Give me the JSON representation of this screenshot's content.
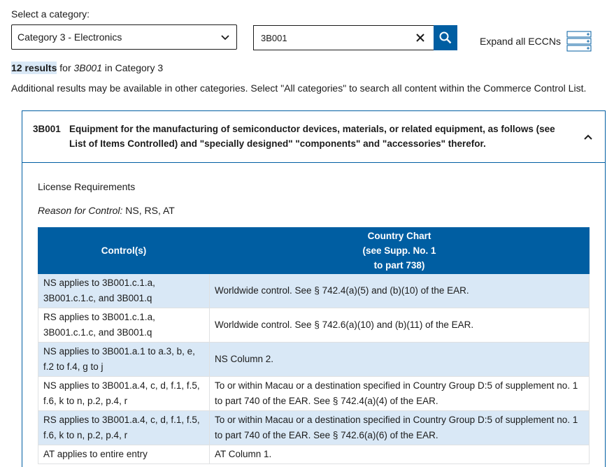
{
  "filters": {
    "category_label": "Select a category:",
    "category_value": "Category 3 - Electronics",
    "search_value": "3B001",
    "expand_all_label": "Expand all ECCNs"
  },
  "results": {
    "count": "12 results",
    "for_word": "for",
    "term": "3B001",
    "in_text": "in Category 3",
    "additional": "Additional results may be available in other categories. Select \"All categories\" to search all content within the Commerce Control List."
  },
  "eccn": {
    "code": "3B001",
    "title": "Equipment for the manufacturing of semiconductor devices, materials, or related equipment, as follows (see List of Items Controlled) and \"specially designed\" \"components\" and \"accessories\" therefor.",
    "license_requirements": "License Requirements",
    "reason_label": "Reason for Control:",
    "reason_value": "NS, RS, AT",
    "table": {
      "col1_header": "Control(s)",
      "col2_header_lines": [
        "Country Chart",
        "(see Supp. No. 1",
        "to part 738)"
      ],
      "rows": [
        {
          "control": "NS applies to 3B001.c.1.a, 3B001.c.1.c, and 3B001.q",
          "chart": "Worldwide control. See § 742.4(a)(5) and (b)(10) of the EAR."
        },
        {
          "control": "RS applies to 3B001.c.1.a, 3B001.c.1.c, and 3B001.q",
          "chart": "Worldwide control. See § 742.6(a)(10) and (b)(11) of the EAR."
        },
        {
          "control": "NS applies to 3B001.a.1 to a.3, b, e, f.2 to f.4, g to j",
          "chart": "NS Column 2."
        },
        {
          "control": "NS applies to 3B001.a.4, c, d, f.1, f.5, f.6, k to n, p.2, p.4, r",
          "chart": "To or within Macau or a destination specified in Country Group D:5 of supplement no. 1 to part 740 of the EAR. See § 742.4(a)(4) of the EAR."
        },
        {
          "control": "RS applies to 3B001.a.4, c, d, f.1, f.5, f.6, k to n, p.2, p.4, r",
          "chart": "To or within Macau or a destination specified in Country Group D:5 of supplement no. 1 to part 740 of the EAR. See § 742.6(a)(6) of the EAR."
        },
        {
          "control": "AT applies to entire entry",
          "chart": "AT Column 1."
        }
      ]
    }
  },
  "icons": {
    "select_chevron": "chevron-down-icon",
    "clear": "close-icon",
    "search": "search-icon",
    "expand": "expand-all-icon",
    "accordion_toggle": "chevron-up-icon"
  },
  "colors": {
    "primary": "#005ea2",
    "row_shade": "#d9e8f6"
  }
}
